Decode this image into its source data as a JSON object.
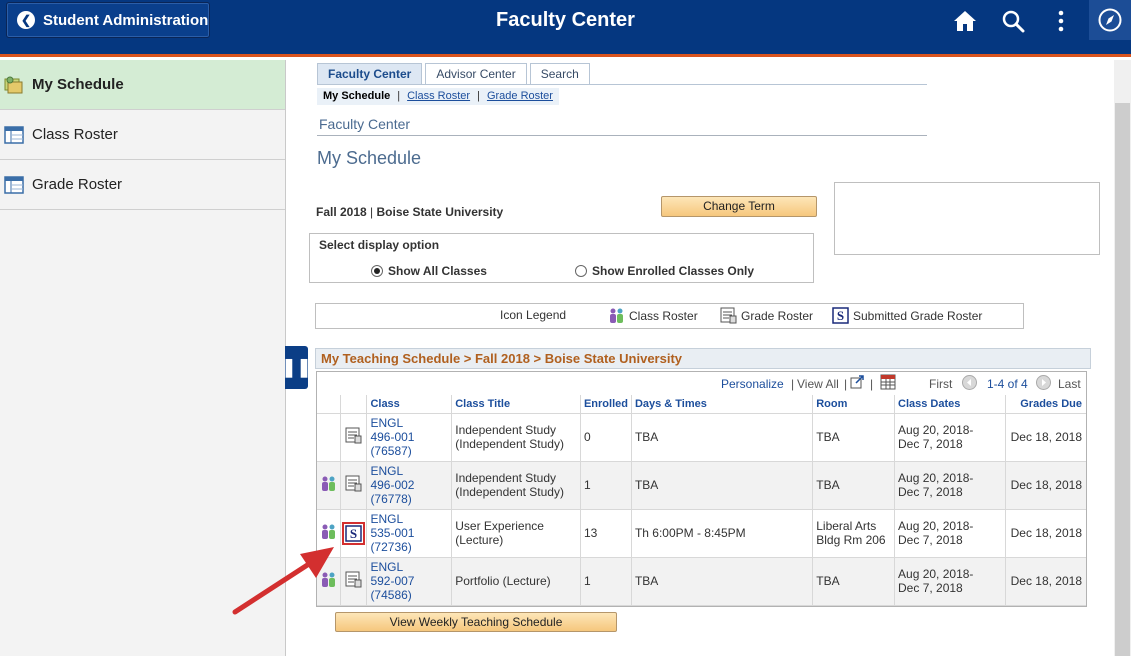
{
  "header": {
    "back_label": "Student Administration",
    "title": "Faculty Center",
    "icons": [
      "home-icon",
      "search-icon",
      "more-vertical-icon",
      "navigator-compass-icon"
    ]
  },
  "sidebar": {
    "items": [
      {
        "label": "My Schedule",
        "active": true,
        "icon": "schedule-icon"
      },
      {
        "label": "Class Roster",
        "active": false,
        "icon": "roster-window-icon"
      },
      {
        "label": "Grade Roster",
        "active": false,
        "icon": "roster-window-icon"
      }
    ]
  },
  "tabs": [
    {
      "label": "Faculty Center",
      "active": true
    },
    {
      "label": "Advisor Center",
      "active": false
    },
    {
      "label": "Search",
      "active": false
    }
  ],
  "subnav": {
    "current": "My Schedule",
    "links": [
      "Class Roster",
      "Grade Roster"
    ],
    "sep": "|"
  },
  "breadcrumb": "Faculty Center",
  "page_title": "My Schedule",
  "term": {
    "term": "Fall 2018",
    "sep": " | ",
    "institution": "Boise State University"
  },
  "change_term_label": "Change Term",
  "display_option": {
    "label": "Select display option",
    "options": [
      {
        "label": "Show All Classes",
        "selected": true
      },
      {
        "label": "Show Enrolled Classes Only",
        "selected": false
      }
    ]
  },
  "legend": {
    "title": "Icon Legend",
    "items": [
      "Class Roster",
      "Grade Roster",
      "Submitted Grade Roster"
    ]
  },
  "schedule": {
    "header": "My Teaching Schedule > Fall 2018 > Boise State University",
    "nav": {
      "personalize": "Personalize",
      "sep": "|",
      "view_all": "View All",
      "first": "First",
      "range": "1-4 of 4",
      "last": "Last"
    },
    "columns": [
      "",
      "",
      "Class",
      "Class Title",
      "Enrolled",
      "Days & Times",
      "Room",
      "Class Dates",
      "Grades Due"
    ],
    "rows": [
      {
        "roster_icon": false,
        "grade_icon": "grade-roster-icon",
        "highlighted": false,
        "class_lines": [
          "ENGL",
          "496-001",
          "(76587)"
        ],
        "title_lines": [
          "Independent Study",
          "(Independent Study)"
        ],
        "enrolled": "0",
        "days_times": "TBA",
        "room_lines": [
          "TBA"
        ],
        "dates_lines": [
          "Aug 20, 2018-",
          "Dec 7, 2018"
        ],
        "grades_due": "Dec 18, 2018"
      },
      {
        "roster_icon": true,
        "grade_icon": "grade-roster-icon",
        "highlighted": false,
        "class_lines": [
          "ENGL",
          "496-002",
          "(76778)"
        ],
        "title_lines": [
          "Independent Study",
          "(Independent Study)"
        ],
        "enrolled": "1",
        "days_times": "TBA",
        "room_lines": [
          "TBA"
        ],
        "dates_lines": [
          "Aug 20, 2018-",
          "Dec 7, 2018"
        ],
        "grades_due": "Dec 18, 2018"
      },
      {
        "roster_icon": true,
        "grade_icon": "submitted-grade-roster-icon",
        "highlighted": true,
        "class_lines": [
          "ENGL",
          "535-001",
          "(72736)"
        ],
        "title_lines": [
          "User Experience",
          "(Lecture)"
        ],
        "enrolled": "13",
        "days_times": "Th 6:00PM - 8:45PM",
        "room_lines": [
          "Liberal Arts",
          "Bldg Rm 206"
        ],
        "dates_lines": [
          "Aug 20, 2018-",
          "Dec 7, 2018"
        ],
        "grades_due": "Dec 18, 2018"
      },
      {
        "roster_icon": true,
        "grade_icon": "grade-roster-icon",
        "highlighted": false,
        "class_lines": [
          "ENGL",
          "592-007",
          "(74586)"
        ],
        "title_lines": [
          "Portfolio (Lecture)"
        ],
        "enrolled": "1",
        "days_times": "TBA",
        "room_lines": [
          "TBA"
        ],
        "dates_lines": [
          "Aug 20, 2018-",
          "Dec 7, 2018"
        ],
        "grades_due": "Dec 18, 2018"
      }
    ]
  },
  "weekly_button_label": "View Weekly Teaching Schedule",
  "annotation": {
    "arrow_color": "#d32f2f"
  },
  "colors": {
    "banner": "#053780",
    "accent": "#d9541e",
    "link": "#1c4e9c",
    "section_header_text": "#b0601f"
  }
}
